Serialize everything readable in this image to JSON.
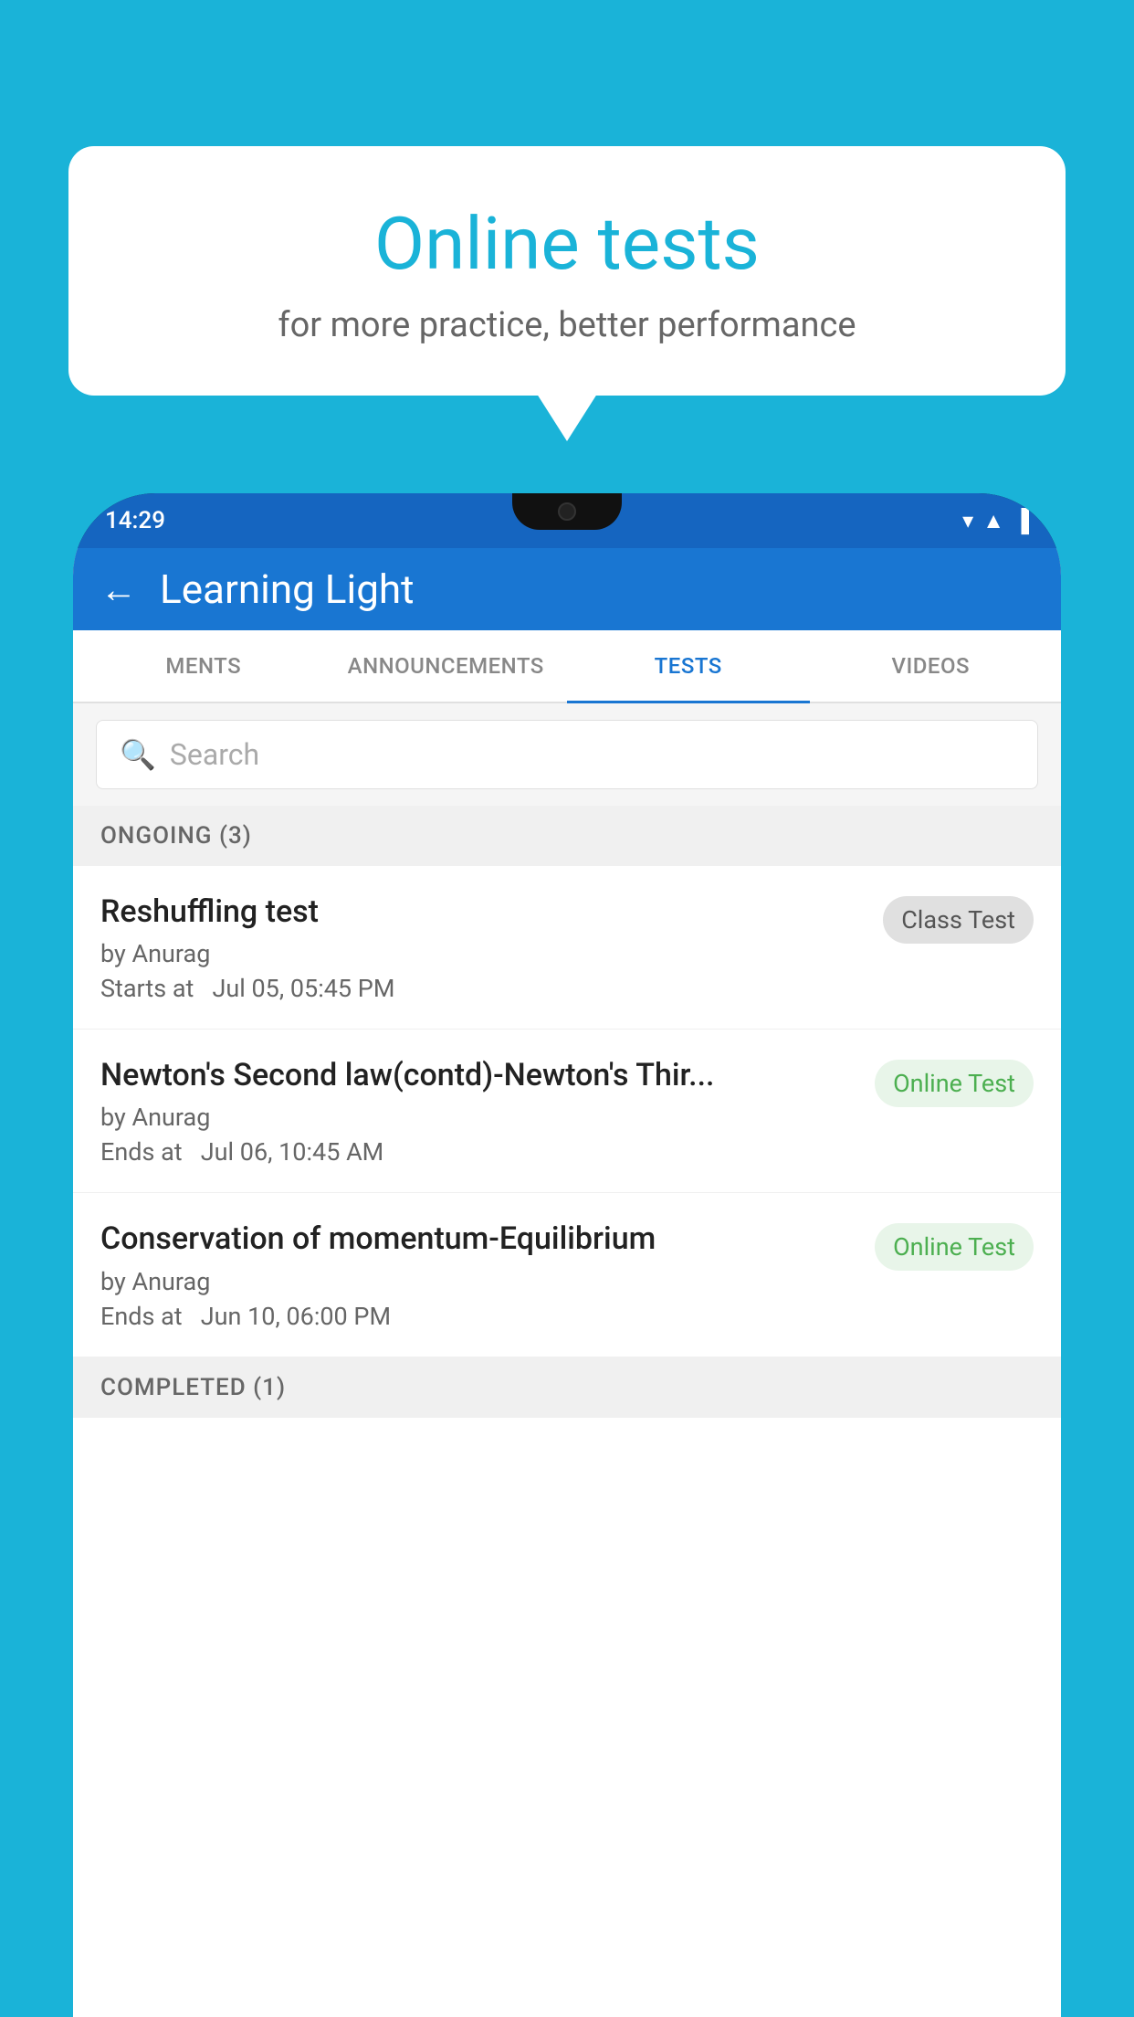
{
  "background": {
    "color": "#1ab3d8"
  },
  "speech_bubble": {
    "title": "Online tests",
    "subtitle": "for more practice, better performance"
  },
  "phone": {
    "status_bar": {
      "time": "14:29",
      "icons": [
        "▼",
        "▲",
        "▐"
      ]
    },
    "app_header": {
      "back_label": "←",
      "title": "Learning Light"
    },
    "tabs": [
      {
        "label": "MENTS",
        "active": false
      },
      {
        "label": "ANNOUNCEMENTS",
        "active": false
      },
      {
        "label": "TESTS",
        "active": true
      },
      {
        "label": "VIDEOS",
        "active": false
      }
    ],
    "search": {
      "placeholder": "Search",
      "icon": "🔍"
    },
    "sections": [
      {
        "header": "ONGOING (3)",
        "items": [
          {
            "name": "Reshuffling test",
            "author": "by Anurag",
            "time_label": "Starts at",
            "time": "Jul 05, 05:45 PM",
            "badge": "Class Test",
            "badge_type": "class"
          },
          {
            "name": "Newton's Second law(contd)-Newton's Thir...",
            "author": "by Anurag",
            "time_label": "Ends at",
            "time": "Jul 06, 10:45 AM",
            "badge": "Online Test",
            "badge_type": "online"
          },
          {
            "name": "Conservation of momentum-Equilibrium",
            "author": "by Anurag",
            "time_label": "Ends at",
            "time": "Jun 10, 06:00 PM",
            "badge": "Online Test",
            "badge_type": "online"
          }
        ]
      },
      {
        "header": "COMPLETED (1)",
        "items": []
      }
    ]
  }
}
